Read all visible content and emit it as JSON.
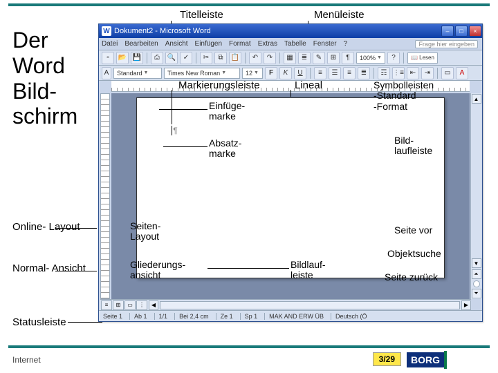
{
  "slide": {
    "title": "Der\nWord\nBild-\nschirm"
  },
  "labels": {
    "titelleiste": "Titelleiste",
    "menuleiste": "Menüleiste",
    "markierungsleiste": "Markierungsleiste",
    "lineal": "Lineal",
    "symbolleisten": "Symbolleisten\n -Standard\n -Format",
    "einfugemarke": "Einfüge-\nmarke",
    "absatzmarke": "Absatz-\nmarke",
    "bildlaufleiste_r": "Bild-\nlaufleiste",
    "online_layout": "Online-\nLayout",
    "normal_ansicht": "Normal-\nAnsicht",
    "statusleiste": "Statusleiste",
    "seiten_layout": "Seiten-\nLayout",
    "gliederungsansicht": "Gliederungs-\nansicht",
    "bildlaufleiste_h": "Bildlauf-\nleiste",
    "seite_vor": "Seite vor",
    "objektsuche": "Objektsuche",
    "seite_zurueck": "Seite zurück"
  },
  "word": {
    "title": "Dokument2 - Microsoft Word",
    "help_prompt": "Frage hier eingeben",
    "menus": [
      "Datei",
      "Bearbeiten",
      "Ansicht",
      "Einfügen",
      "Format",
      "Extras",
      "Tabelle",
      "Fenster",
      "?"
    ],
    "style": "Standard",
    "font": "Times New Roman",
    "size": "12",
    "zoom": "100%",
    "bold": "F",
    "italic": "K",
    "underline": "U",
    "status": {
      "seite": "Seite 1",
      "ab": "Ab 1",
      "von": "1/1",
      "bei": "Bei 2,4 cm",
      "ze": "Ze 1",
      "sp": "Sp 1",
      "modes": "MAK  AND  ERW  ÜB",
      "lang": "Deutsch (Ö"
    }
  },
  "footer": {
    "link": "Internet",
    "page": "3/29",
    "logo": "BORG"
  }
}
